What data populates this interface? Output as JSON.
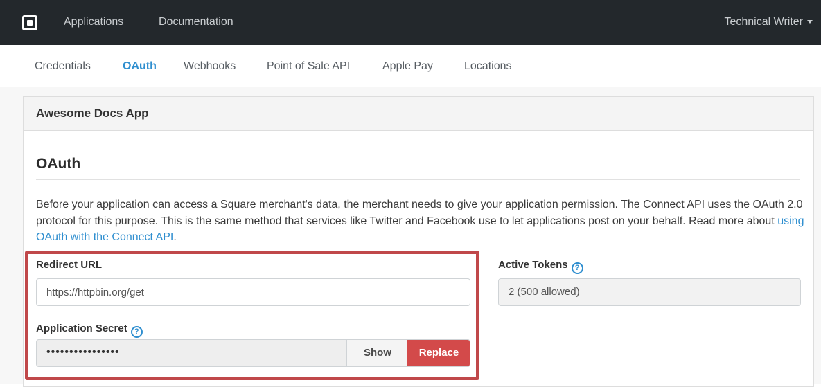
{
  "topbar": {
    "logo": "square-logo-icon",
    "links": [
      "Applications",
      "Documentation"
    ],
    "user": "Technical Writer"
  },
  "subnav": {
    "items": [
      "Credentials",
      "OAuth",
      "Webhooks",
      "Point of Sale API",
      "Apple Pay",
      "Locations"
    ],
    "active": "OAuth"
  },
  "panel": {
    "title": "Awesome Docs App",
    "section_title": "OAuth",
    "description_before_link": "Before your application can access a Square merchant's data, the merchant needs to give your application permission. The Connect API uses the OAuth 2.0 protocol for this purpose. This is the same method that services like Twitter and Facebook use to let applications post on your behalf. Read more about ",
    "description_link": "using OAuth with the Connect API",
    "description_after_link": "."
  },
  "redirect": {
    "label": "Redirect URL",
    "value": "https://httpbin.org/get"
  },
  "secret": {
    "label": "Application Secret",
    "value": "••••••••••••••••",
    "show_label": "Show",
    "replace_label": "Replace"
  },
  "tokens": {
    "label": "Active Tokens",
    "value": "2 (500 allowed)"
  },
  "help_glyph": "?",
  "colors": {
    "topbar": "#23282c",
    "accent": "#2e8ecf",
    "replace": "#d34a4a",
    "highlight": "#c0484a"
  }
}
